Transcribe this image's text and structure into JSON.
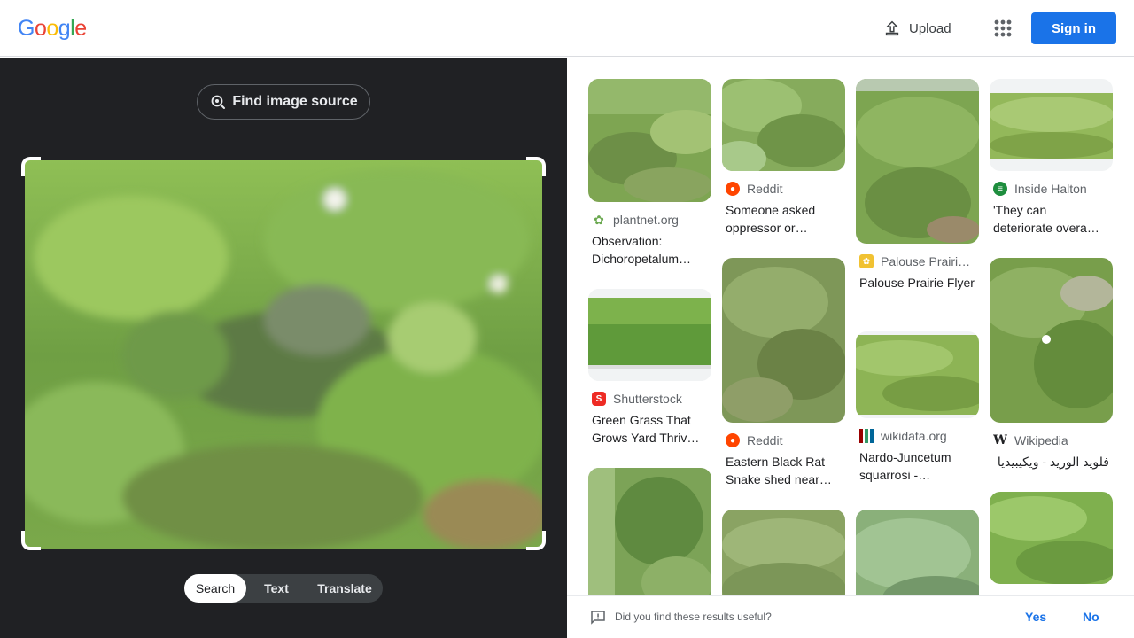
{
  "header": {
    "logo_letters": [
      {
        "ch": "G",
        "color": "#4285f4"
      },
      {
        "ch": "o",
        "color": "#ea4335"
      },
      {
        "ch": "o",
        "color": "#fbbc05"
      },
      {
        "ch": "g",
        "color": "#4285f4"
      },
      {
        "ch": "l",
        "color": "#34a853"
      },
      {
        "ch": "e",
        "color": "#ea4335"
      }
    ],
    "upload_label": "Upload",
    "apps_icon": "apps-grid-icon",
    "signin_label": "Sign in"
  },
  "lens": {
    "find_source_label": "Find image source",
    "modes": [
      "Search",
      "Text",
      "Translate"
    ],
    "active_mode": "Search"
  },
  "results": [
    {
      "source": "plantnet.org",
      "title": "Observation: Dichoropetalum…",
      "favicon": "plantnet-icon",
      "fav_color": "#6aa84f"
    },
    {
      "source": "Reddit",
      "title": "Someone asked oppressor or…",
      "favicon": "reddit-icon",
      "fav_color": "#ff4500"
    },
    {
      "source": "Palouse Prairi…",
      "title": "Palouse Prairie Flyer",
      "favicon": "flower-icon",
      "fav_color": "#f1c232"
    },
    {
      "source": "Inside Halton",
      "title": "'They can deteriorate overa…",
      "favicon": "insidehalton-icon",
      "fav_color": "#1e8e3e"
    },
    {
      "source": "Shutterstock",
      "title": "Green Grass That Grows Yard Thriv…",
      "favicon": "shutterstock-icon",
      "fav_color": "#ee2b24"
    },
    {
      "source": "Reddit",
      "title": "Eastern Black Rat Snake shed near…",
      "favicon": "reddit-icon",
      "fav_color": "#ff4500"
    },
    {
      "source": "wikidata.org",
      "title": "Nardo-Juncetum squarrosi -…",
      "favicon": "wikidata-icon",
      "fav_color": "#990000"
    },
    {
      "source": "Wikipedia",
      "title": "فلويد الوريد - ويكيبيديا",
      "favicon": "wikipedia-icon",
      "fav_color": "#000000"
    }
  ],
  "feedback": {
    "question": "Did you find these results useful?",
    "yes": "Yes",
    "no": "No"
  }
}
